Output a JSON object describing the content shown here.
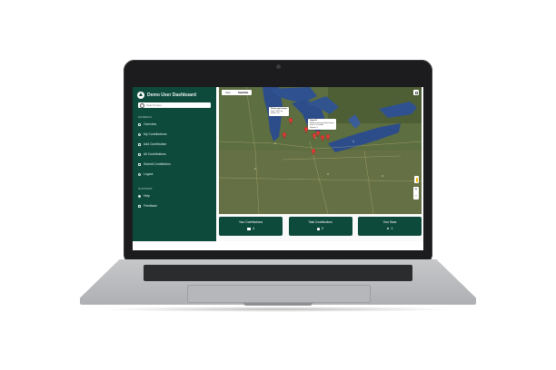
{
  "app": {
    "title": "Demo User Dashboard",
    "search_placeholder": "Search Here",
    "accent_color": "#0e4a3c"
  },
  "sidebar": {
    "general_label": "GENERAL",
    "items": [
      {
        "label": "Overview",
        "icon": "grid-icon"
      },
      {
        "label": "My Contributions",
        "icon": "user-icon"
      },
      {
        "label": "Add Contribution",
        "icon": "plus-icon"
      },
      {
        "label": "All Contributions",
        "icon": "list-icon"
      },
      {
        "label": "Submit Contribution",
        "icon": "upload-icon"
      },
      {
        "label": "Logout",
        "icon": "logout-icon"
      }
    ],
    "support_label": "SUPPORT",
    "support_items": [
      {
        "label": "Help",
        "icon": "help-icon"
      },
      {
        "label": "Feedback",
        "icon": "feedback-icon"
      }
    ]
  },
  "map": {
    "tab_map": "Map",
    "tab_satellite": "Satellite",
    "zoom_in": "+",
    "zoom_out": "−",
    "infowindow_1": {
      "title": "Perfect got crops",
      "line1": "Total: 432 ft sq",
      "line2": "Status: OK"
    },
    "infowindow_2": {
      "title": "Good 4",
      "line1": "Wallace along peatland native",
      "line2": "Score: 55 meters",
      "line3": "Review: 4"
    }
  },
  "stats": [
    {
      "title": "Your Contributions",
      "value": "4",
      "icon": "map-icon"
    },
    {
      "title": "Total Contributions",
      "value": "2",
      "icon": "people-icon"
    },
    {
      "title": "Your Stars",
      "value": "1",
      "icon": "star-icon"
    }
  ]
}
